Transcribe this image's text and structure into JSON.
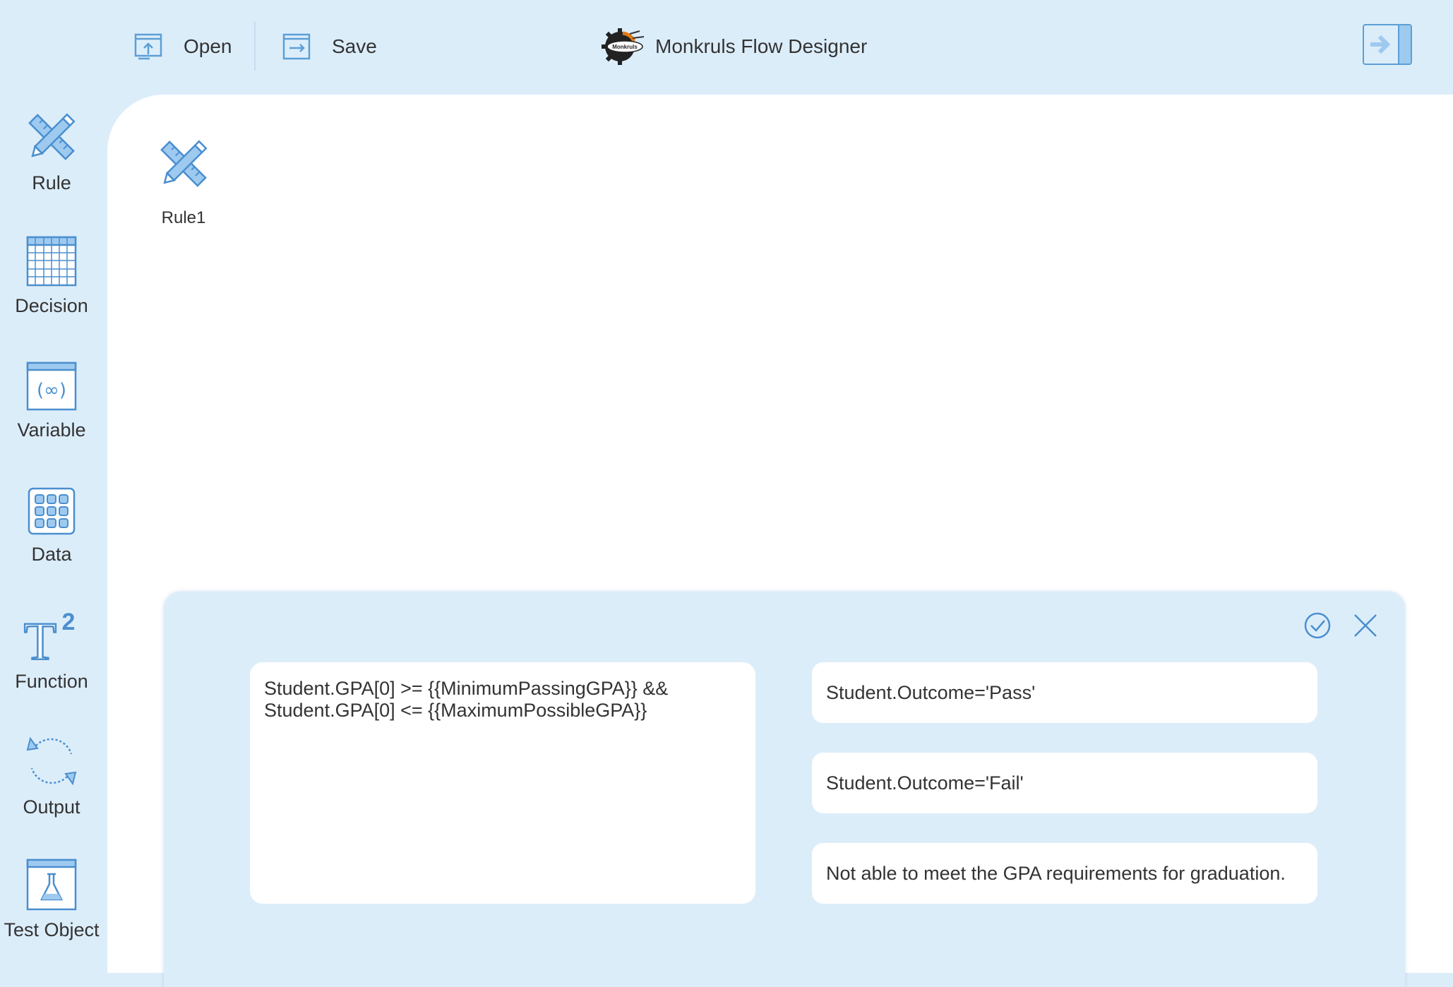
{
  "toolbar": {
    "open_label": "Open",
    "save_label": "Save",
    "app_title": "Monkruls Flow Designer",
    "logo_text": "Monkruls"
  },
  "sidebar": {
    "items": [
      {
        "label": "Rule",
        "icon": "rule-icon"
      },
      {
        "label": "Decision",
        "icon": "grid-icon"
      },
      {
        "label": "Variable",
        "icon": "variable-icon"
      },
      {
        "label": "Data",
        "icon": "data-icon"
      },
      {
        "label": "Function",
        "icon": "function-icon"
      },
      {
        "label": "Output",
        "icon": "output-icon"
      },
      {
        "label": "Test Object",
        "icon": "test-object-icon"
      }
    ]
  },
  "canvas": {
    "nodes": [
      {
        "label": "Rule1",
        "icon": "rule-icon"
      }
    ]
  },
  "editor": {
    "condition": "Student.GPA[0] >= {{MinimumPassingGPA}} &&\nStudent.GPA[0] <= {{MaximumPossibleGPA}}",
    "actions": [
      "Student.Outcome='Pass'",
      "Student.Outcome='Fail'",
      "Not able to meet the GPA requirements for graduation."
    ]
  },
  "colors": {
    "background": "#dcedfa",
    "accent": "#5b9fd6",
    "icon_fill": "#9ecaf0"
  }
}
